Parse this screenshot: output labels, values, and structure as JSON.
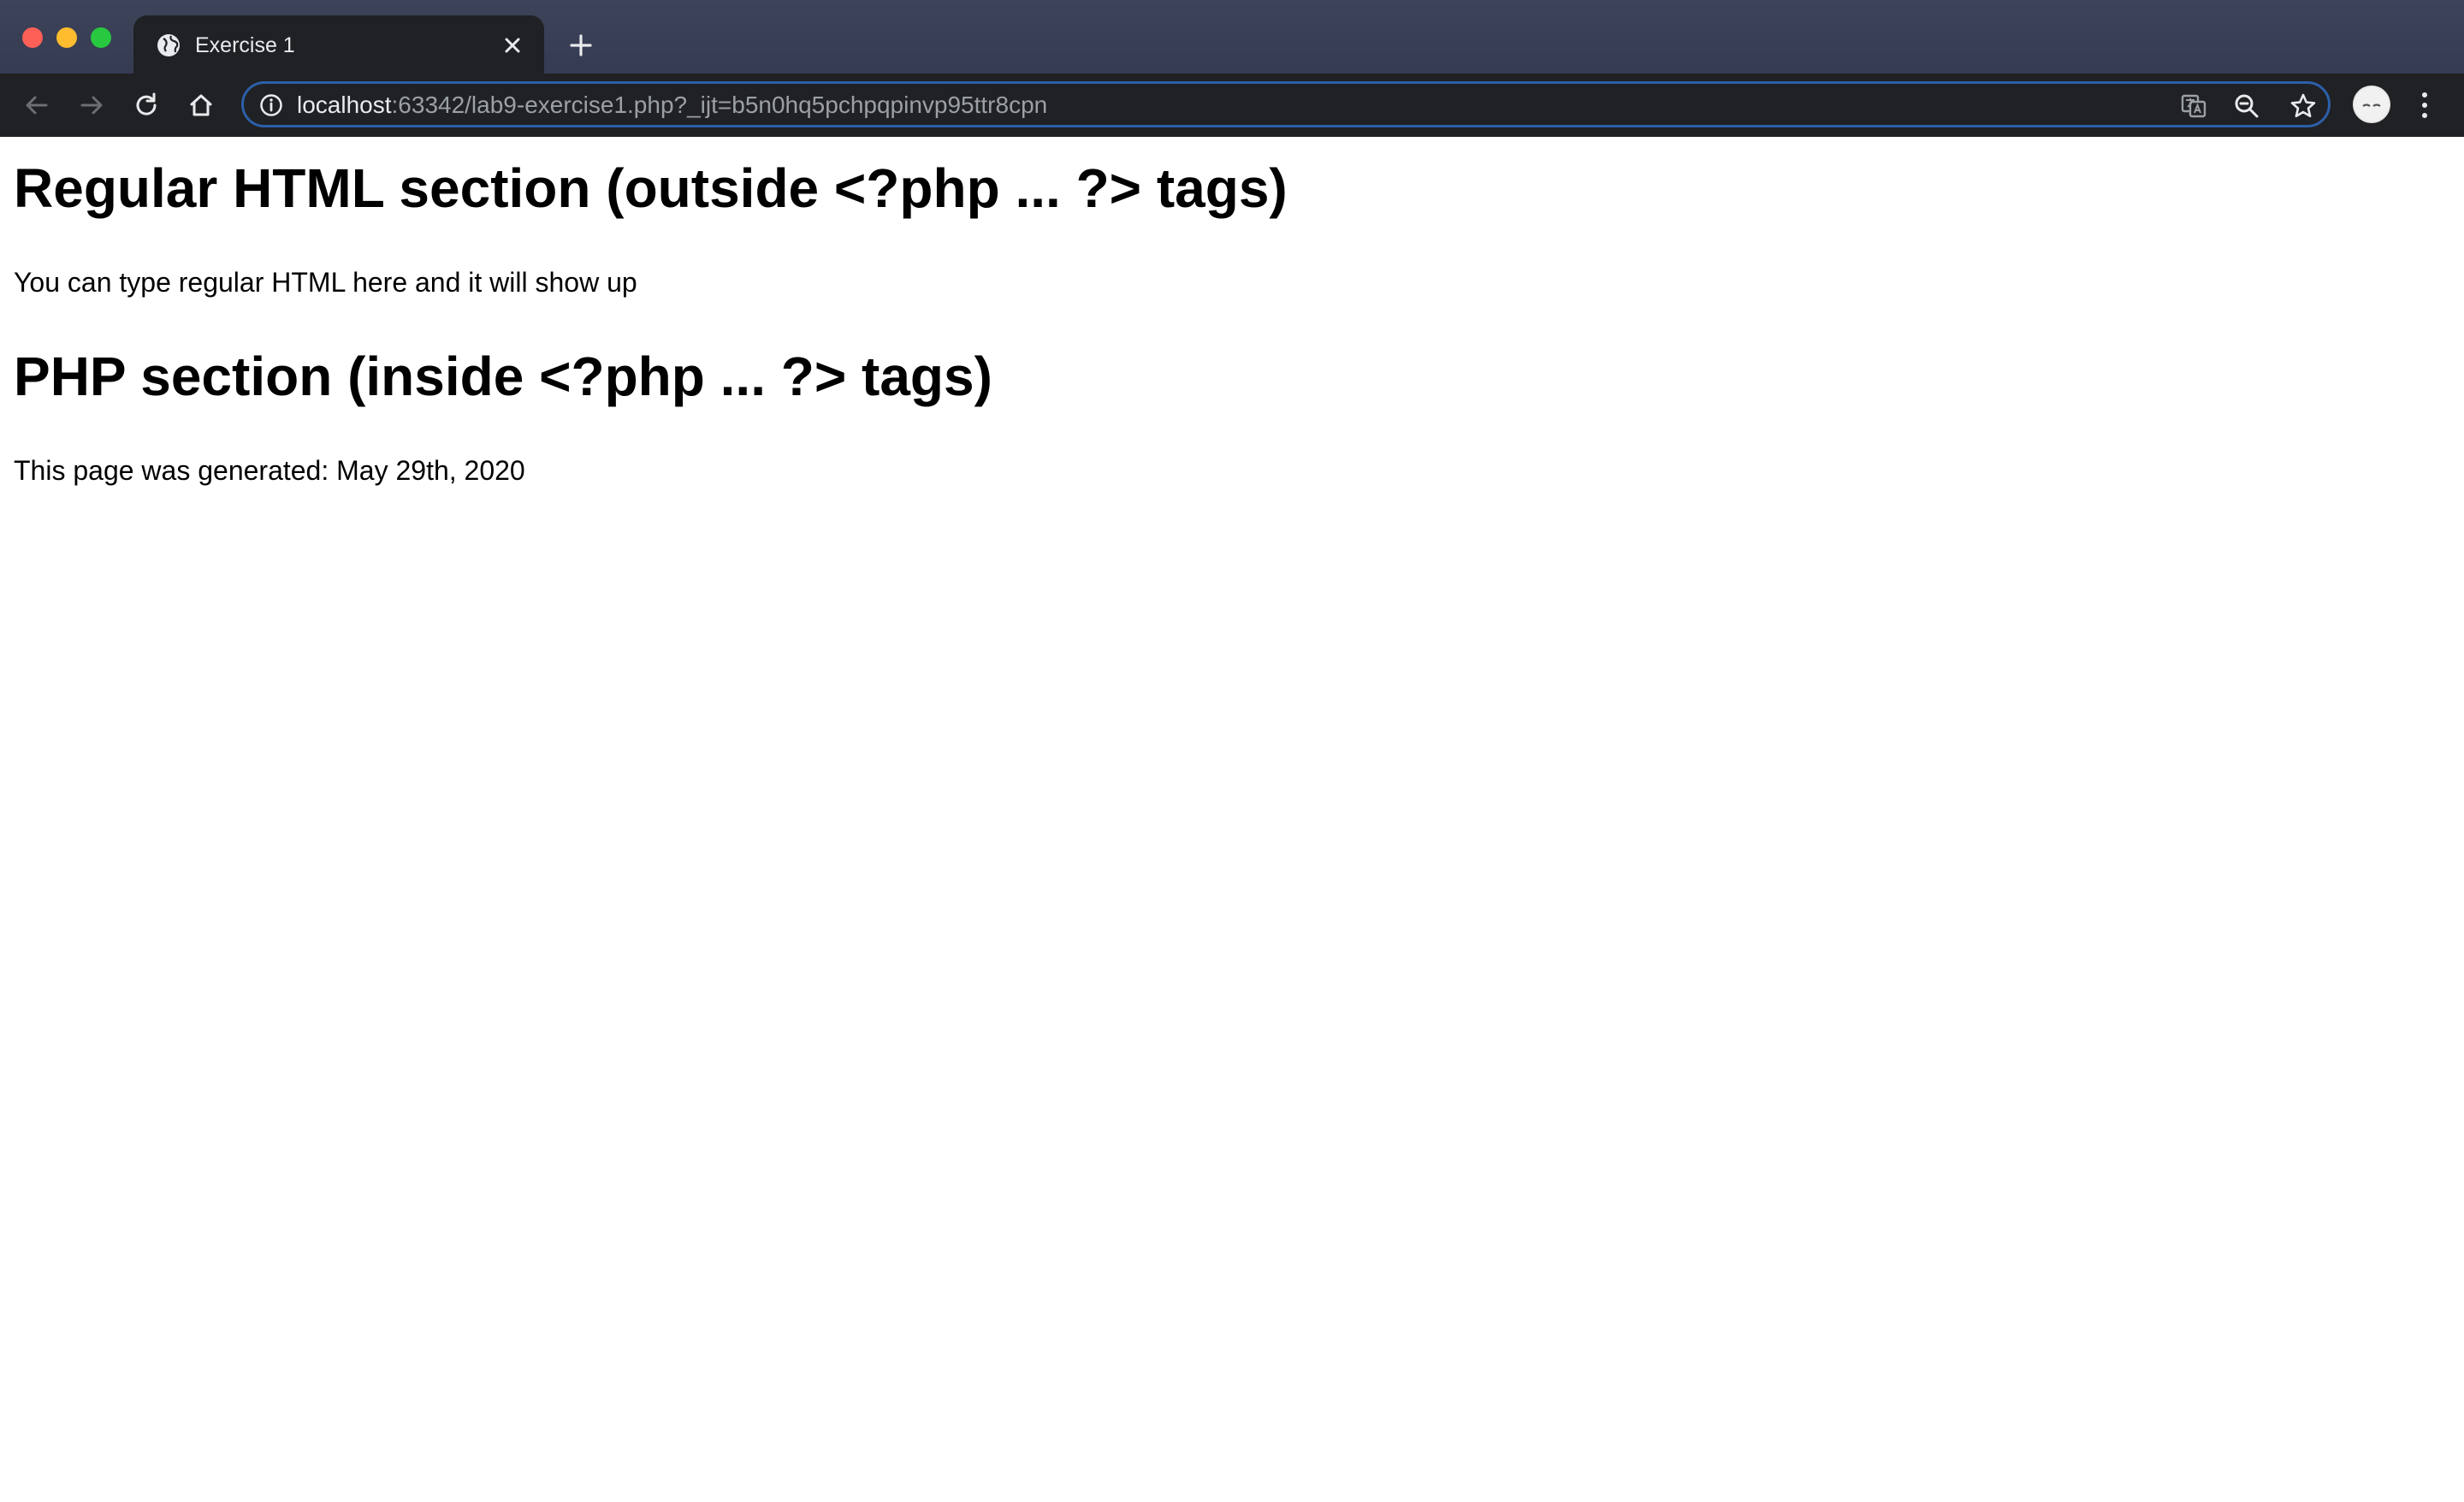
{
  "window": {
    "traffic_lights": [
      "close",
      "minimize",
      "maximize"
    ]
  },
  "tabs": [
    {
      "title": "Exercise 1",
      "icon": "globe-icon",
      "active": true
    }
  ],
  "toolbar": {
    "back_icon": "back-arrow-icon",
    "forward_icon": "forward-arrow-icon",
    "reload_icon": "reload-icon",
    "home_icon": "home-icon",
    "url_host": "localhost",
    "url_rest": ":63342/lab9-exercise1.php?_ijt=b5n0hq5pchpqpinvp95ttr8cpn",
    "translate_icon": "translate-icon",
    "zoom_icon": "zoom-icon",
    "bookmark_icon": "star-icon",
    "menu_icon": "more-vertical-icon"
  },
  "page": {
    "heading1": "Regular HTML section (outside <?php ... ?> tags)",
    "paragraph1": "You can type regular HTML here and it will show up",
    "heading2": "PHP section (inside <?php ... ?> tags)",
    "paragraph2": "This page was generated: May 29th, 2020"
  },
  "colors": {
    "tabstrip_bg": "#3a4056",
    "toolbar_bg": "#202124",
    "omnibox_border": "#2d5fa8",
    "text_light": "#e8eaed",
    "text_muted": "#9aa0a6",
    "close": "#fe5f57",
    "minimize": "#febc2e",
    "maximize": "#28c840"
  }
}
